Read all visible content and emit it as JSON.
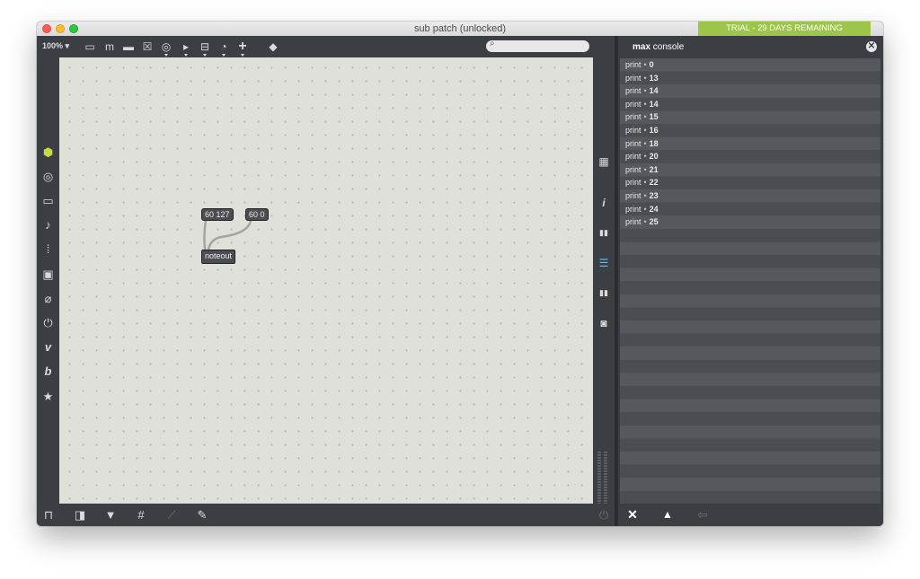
{
  "window": {
    "title": "sub patch (unlocked)",
    "trial_banner": "TRIAL - 29 DAYS REMAINING",
    "accent_color": "#9dc54b"
  },
  "toolbar": {
    "zoom": "100%",
    "zoom_caret": "▾",
    "tools": [
      {
        "icon": "new-object-icon",
        "glyph": "▭"
      },
      {
        "icon": "message-icon",
        "glyph": "m"
      },
      {
        "icon": "comment-icon",
        "glyph": "▬"
      },
      {
        "icon": "toggle-icon",
        "glyph": "☒"
      },
      {
        "icon": "button-icon",
        "glyph": "◎"
      },
      {
        "icon": "play-icon",
        "glyph": "▸"
      },
      {
        "icon": "slider-icon",
        "glyph": "⊟"
      },
      {
        "icon": "dial-icon",
        "glyph": "◔"
      },
      {
        "icon": "add-icon",
        "glyph": "+"
      },
      {
        "icon": "paint-bucket-icon",
        "glyph": "◆"
      }
    ],
    "search_glyph": "⌕"
  },
  "left_sidebar": [
    {
      "icon": "package-cube-icon",
      "glyph": "⬢"
    },
    {
      "icon": "target-icon",
      "glyph": "◎"
    },
    {
      "icon": "film-icon",
      "glyph": "▭"
    },
    {
      "icon": "music-note-icon",
      "glyph": "♪"
    },
    {
      "icon": "sequence-icon",
      "glyph": "⁞"
    },
    {
      "icon": "image-icon",
      "glyph": "▣"
    },
    {
      "icon": "paperclip-icon",
      "glyph": "⌀"
    },
    {
      "icon": "plug-icon",
      "glyph": "⏻"
    },
    {
      "icon": "v-badge-icon",
      "glyph": "v"
    },
    {
      "icon": "b-badge-icon",
      "glyph": "b"
    },
    {
      "icon": "star-icon",
      "glyph": "★"
    }
  ],
  "patch": {
    "messages": [
      "60 127",
      "60 0"
    ],
    "object": "noteout",
    "cord_color": "#a5a5a0"
  },
  "right_strip": [
    {
      "icon": "grid-meter-icon",
      "glyph": "▦"
    },
    {
      "icon": "info-icon",
      "glyph": "i"
    },
    {
      "icon": "reference-book-icon",
      "glyph": "▮▮"
    },
    {
      "icon": "list-icon",
      "glyph": "☰"
    },
    {
      "icon": "book-icon",
      "glyph": "▮▮"
    },
    {
      "icon": "snapshot-icon",
      "glyph": "◙"
    }
  ],
  "bottom_toolbar": [
    {
      "icon": "lock-icon",
      "glyph": "⊓"
    },
    {
      "icon": "windows-icon",
      "glyph": "◨"
    },
    {
      "icon": "presentation-icon",
      "glyph": "▼"
    },
    {
      "icon": "grid-icon",
      "glyph": "#"
    },
    {
      "icon": "snap-icon",
      "glyph": "⟋"
    },
    {
      "icon": "wrench-icon",
      "glyph": "✎"
    }
  ],
  "power_glyph": "⏻",
  "console": {
    "title_bold": "max",
    "title_rest": " console",
    "close_glyph": "✕",
    "rows": [
      {
        "source": "print",
        "value": "0"
      },
      {
        "source": "print",
        "value": "13"
      },
      {
        "source": "print",
        "value": "14"
      },
      {
        "source": "print",
        "value": "14"
      },
      {
        "source": "print",
        "value": "15"
      },
      {
        "source": "print",
        "value": "16"
      },
      {
        "source": "print",
        "value": "18"
      },
      {
        "source": "print",
        "value": "20"
      },
      {
        "source": "print",
        "value": "21"
      },
      {
        "source": "print",
        "value": "22"
      },
      {
        "source": "print",
        "value": "23"
      },
      {
        "source": "print",
        "value": "24"
      },
      {
        "source": "print",
        "value": "25"
      }
    ],
    "row_separator": "•",
    "footer": [
      {
        "icon": "clear-x-icon",
        "glyph": "✕"
      },
      {
        "icon": "warning-icon",
        "glyph": "▲"
      },
      {
        "icon": "back-arrow-icon",
        "glyph": "⇦"
      }
    ]
  }
}
